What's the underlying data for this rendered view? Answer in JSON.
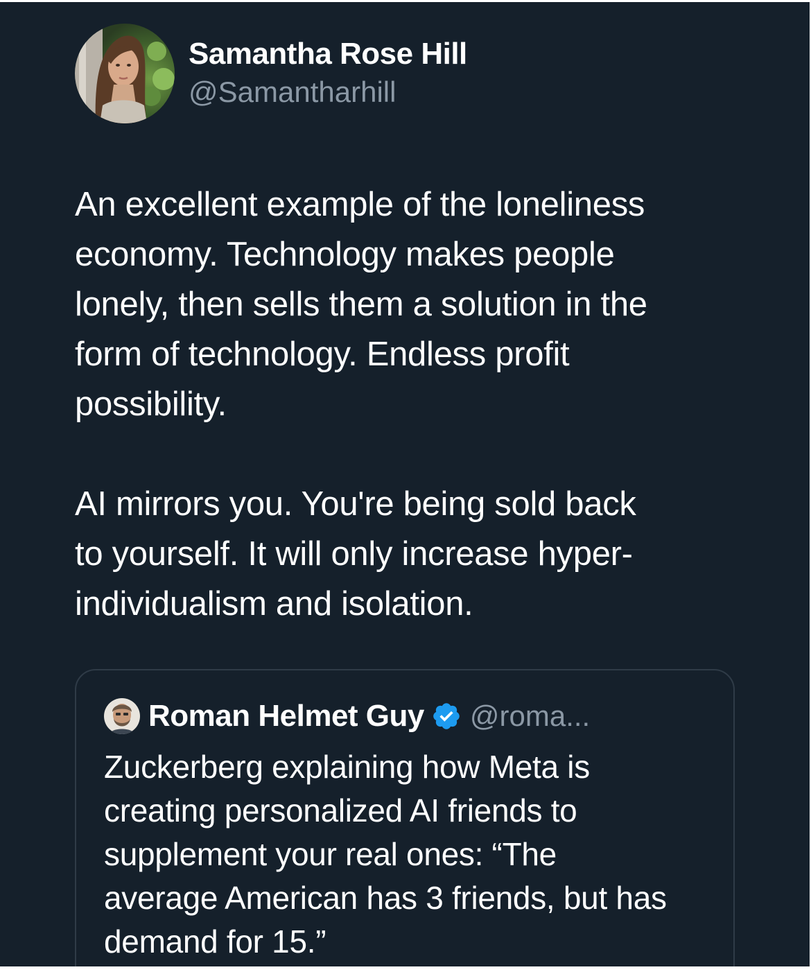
{
  "colors": {
    "background": "#15202b",
    "text_primary": "#ffffff",
    "text_secondary": "#8b98a5",
    "quote_border": "#2f3b47",
    "verified_badge": "#1d9bf0"
  },
  "tweet": {
    "author": {
      "name": "Samantha Rose Hill",
      "handle": "@Samantharhill",
      "avatar_icon": "profile-photo"
    },
    "paragraphs": [
      "An excellent example of the loneliness\neconomy. Technology makes people\nlonely, then sells them a solution in the\nform of technology. Endless profit\npossibility.",
      "AI mirrors you. You're being sold back\nto yourself. It will only increase hyper-\nindividualism and isolation."
    ]
  },
  "quoted_tweet": {
    "author": {
      "name": "Roman Helmet Guy",
      "handle": "@roma...",
      "verified": true,
      "avatar_icon": "profile-photo"
    },
    "text": "Zuckerberg explaining how Meta is\ncreating personalized AI friends to\nsupplement your real ones: “The\naverage American has 3 friends, but has\ndemand for 15.”"
  }
}
